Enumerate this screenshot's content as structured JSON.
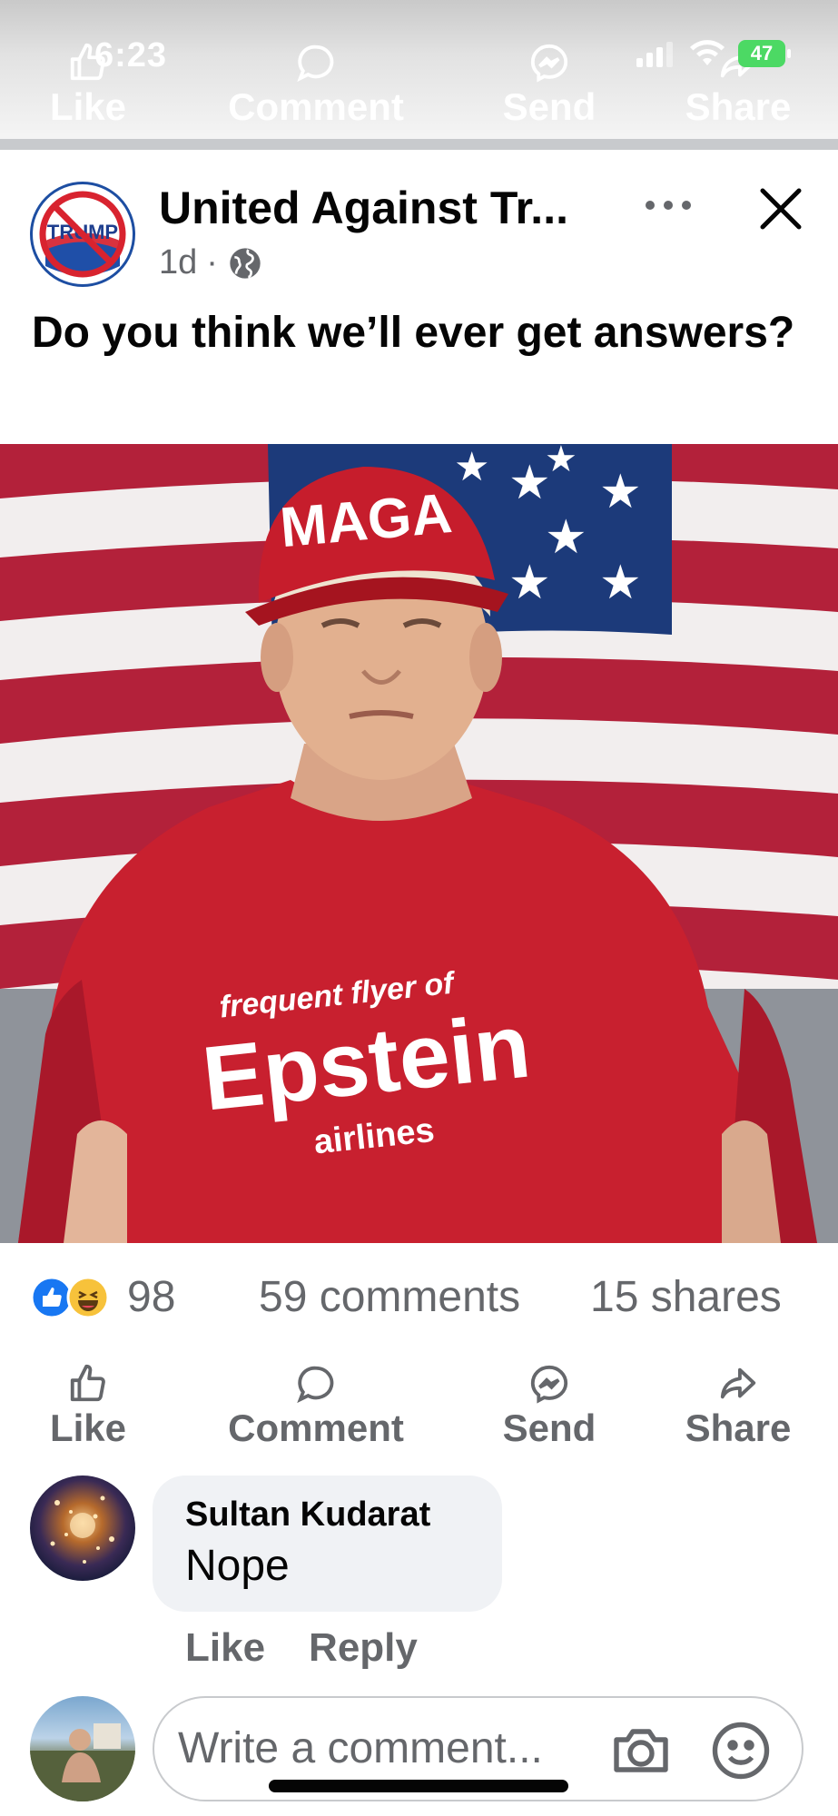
{
  "status_bar": {
    "time": "6:23",
    "battery": "47"
  },
  "prev_post_actions": {
    "like": "Like",
    "comment": "Comment",
    "send": "Send",
    "share": "Share"
  },
  "post": {
    "page_name": "United Against Tr...",
    "page_logo_text": "TRUMP",
    "age": "1d",
    "separator": "·",
    "text": "Do you think we’ll ever get answers?",
    "photo": {
      "hat_text": "MAGA",
      "shirt_line1": "frequent flyer of",
      "shirt_line2": "Epstein",
      "shirt_line3": "airlines"
    }
  },
  "counts": {
    "reactions": "98",
    "comments": "59 comments",
    "shares": "15 shares"
  },
  "actions": {
    "like": "Like",
    "comment": "Comment",
    "send": "Send",
    "share": "Share"
  },
  "comment": {
    "author": "Sultan Kudarat",
    "text": "Nope",
    "like": "Like",
    "reply": "Reply"
  },
  "composer": {
    "placeholder": "Write a comment..."
  },
  "colors": {
    "facebook_blue": "#0866ff",
    "secondary_text": "#65676b",
    "bubble_bg": "#f0f2f5",
    "shirt_red": "#c8202f"
  }
}
